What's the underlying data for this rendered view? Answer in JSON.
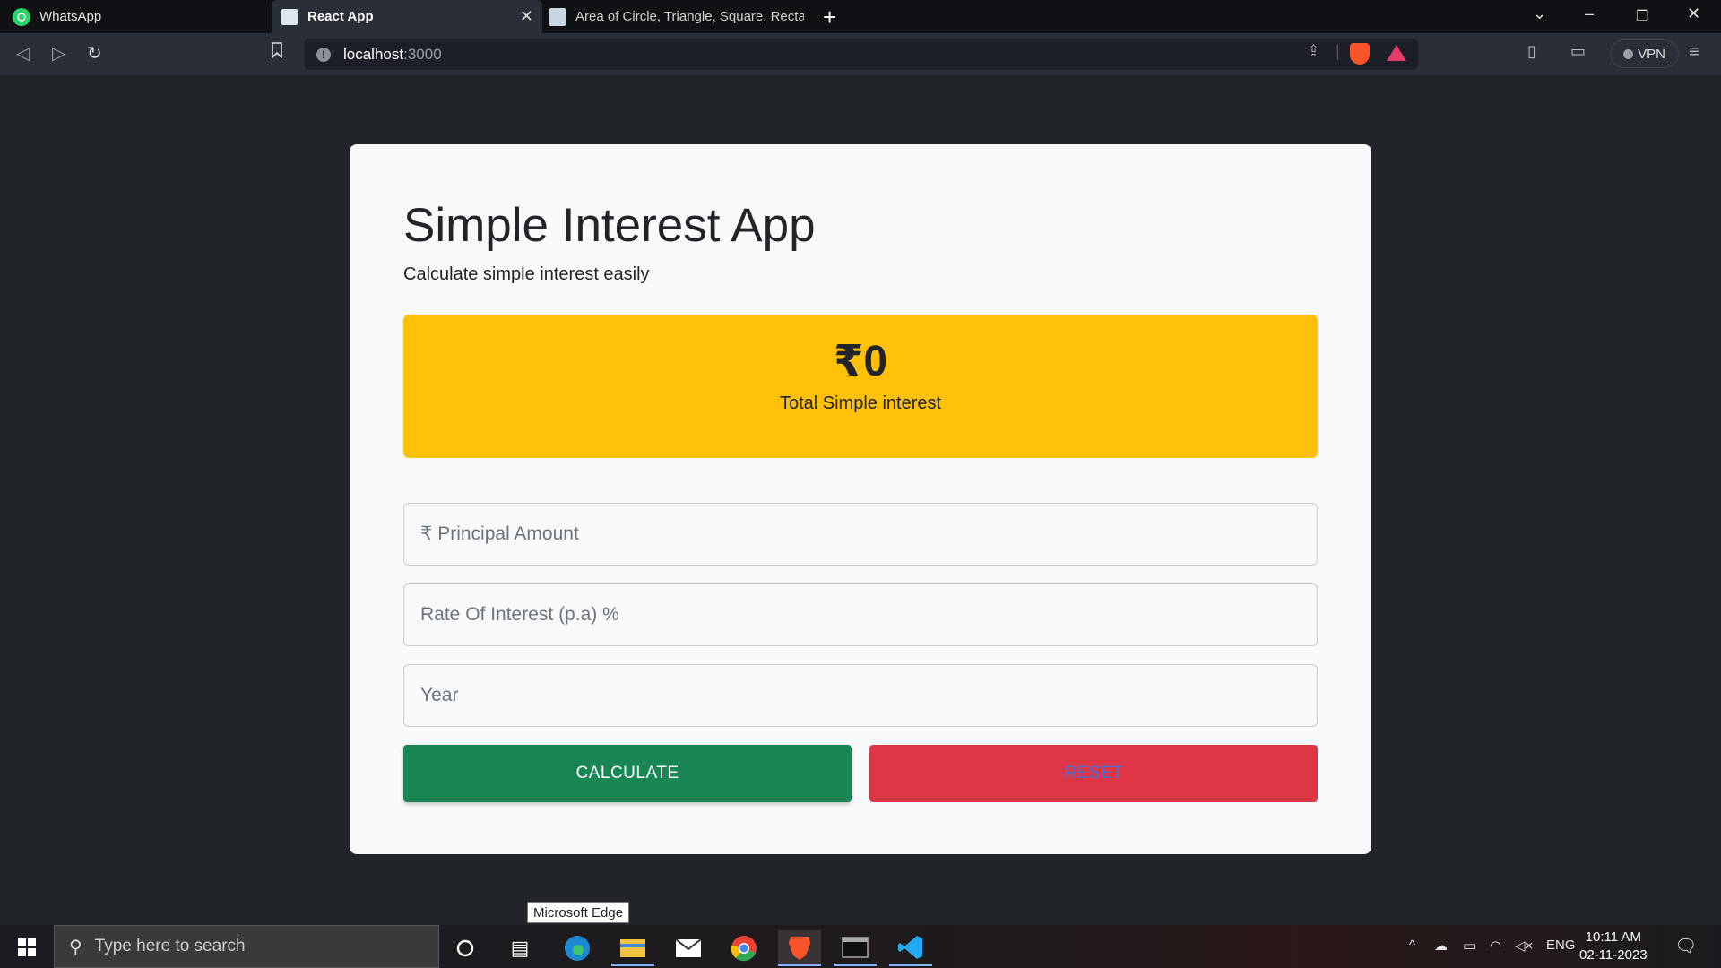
{
  "browser": {
    "tabs": [
      {
        "label": "WhatsApp"
      },
      {
        "label": "React App"
      },
      {
        "label": "Area of Circle, Triangle, Square, Rectan"
      }
    ],
    "url_host": "localhost",
    "url_port": ":3000",
    "vpn_label": "VPN"
  },
  "app": {
    "title": "Simple Interest App",
    "subtitle": "Calculate simple interest easily",
    "result_amount": "₹0",
    "result_label": "Total Simple interest",
    "fields": {
      "principal_placeholder": "₹ Principal Amount",
      "rate_placeholder": "Rate Of Interest (p.a) %",
      "year_placeholder": "Year"
    },
    "calculate_label": "CALCULATE",
    "reset_label": "RESET"
  },
  "tooltip": "Microsoft Edge",
  "taskbar": {
    "search_placeholder": "Type here to search",
    "lang": "ENG",
    "time": "10:11 AM",
    "date": "02-11-2023"
  },
  "colors": {
    "result_bg": "#ffc107",
    "calculate_bg": "#198754",
    "reset_bg": "#dc3545",
    "page_bg": "#212529"
  },
  "icons": [
    "whatsapp-icon",
    "react-favicon",
    "close-icon",
    "plus-icon",
    "back-icon",
    "forward-icon",
    "reload-icon",
    "bookmark-icon",
    "info-icon",
    "share-icon",
    "brave-shield-icon",
    "brave-rewards-icon",
    "sidebar-icon",
    "wallet-icon",
    "menu-icon",
    "windows-start-icon",
    "search-icon",
    "cortana-icon",
    "task-view-icon",
    "edge-icon",
    "file-explorer-icon",
    "mail-icon",
    "chrome-icon",
    "brave-icon",
    "terminal-icon",
    "vscode-icon",
    "notification-icon"
  ]
}
